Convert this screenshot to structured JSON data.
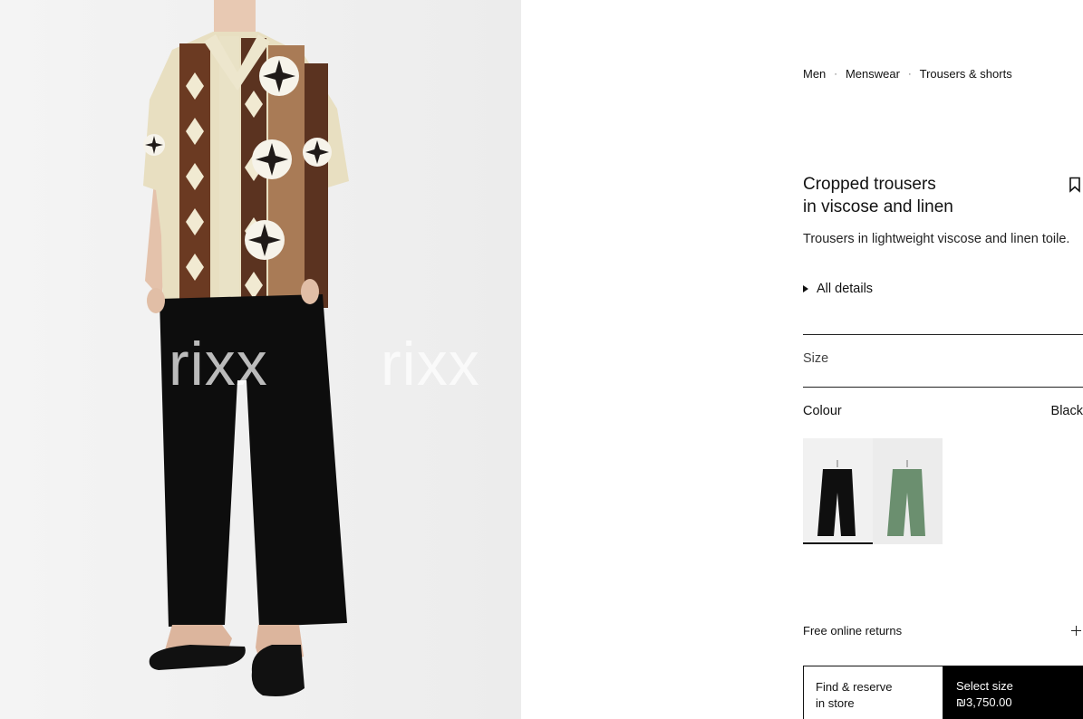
{
  "breadcrumbs": [
    "Men",
    "Menswear",
    "Trousers & shorts"
  ],
  "breadcrumb_separator": "·",
  "product": {
    "title_line1": "Cropped trousers",
    "title_line2": "in viscose and linen",
    "description": "Trousers in lightweight viscose and linen toile.",
    "details_label": "All details"
  },
  "hero": {
    "watermark_left": "rixx",
    "watermark_right": "rixx"
  },
  "size": {
    "label": "Size"
  },
  "colour": {
    "label": "Colour",
    "selected": "Black",
    "options": [
      {
        "name": "Black",
        "color": "#111111"
      },
      {
        "name": "Green",
        "color": "#6b8f6f"
      }
    ]
  },
  "returns": {
    "label": "Free online returns",
    "icon": "plus-icon"
  },
  "actions": {
    "store_line1": "Find & reserve",
    "store_line2": "in store",
    "size_line1": "Select size",
    "price": "₪3,750.00"
  },
  "icons": {
    "bookmark": "bookmark-icon",
    "details": "triangle-right-icon"
  }
}
